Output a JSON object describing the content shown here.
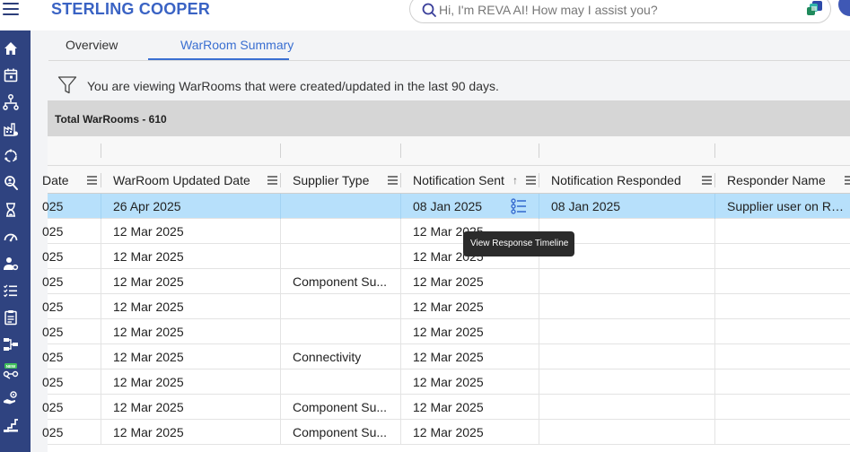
{
  "header": {
    "brand": "STERLING COOPER",
    "search_placeholder": "Hi, I'm REVA AI! How may I assist you?"
  },
  "sidebar": {
    "items": [
      "home-icon",
      "calendar-icon",
      "hierarchy-icon",
      "factory-icon",
      "cycle-icon",
      "search-person-icon",
      "hourglass-icon",
      "gauge-icon",
      "user-settings-icon",
      "list-check-icon",
      "clipboard-icon",
      "org-chart-icon",
      "new-network-icon",
      "hand-gear-icon",
      "stairs-icon"
    ],
    "new_badge": "NEW"
  },
  "tabs": [
    {
      "label": "Overview",
      "active": false
    },
    {
      "label": "WarRoom Summary",
      "active": true
    }
  ],
  "filter_text": "You are viewing WarRooms that were created/updated in the last 90 days.",
  "total_label": "Total WarRooms - 610",
  "columns": {
    "c0": "Date",
    "c1": "WarRoom Updated Date",
    "c2": "Supplier Type",
    "c3": "Notification Sent",
    "c3_sort": "↑",
    "c4": "Notification Responded",
    "c5": "Responder Name"
  },
  "rows": [
    {
      "c0": "025",
      "c1": "26 Apr 2025",
      "c2": "",
      "c3": "08 Jan 2025",
      "c4": "08 Jan 2025",
      "c5": "Supplier user on Re..."
    },
    {
      "c0": "025",
      "c1": "12 Mar 2025",
      "c2": "",
      "c3": "12 Mar 2025",
      "c4": "",
      "c5": ""
    },
    {
      "c0": "025",
      "c1": "12 Mar 2025",
      "c2": "",
      "c3": "12 Mar 2025",
      "c4": "",
      "c5": ""
    },
    {
      "c0": "025",
      "c1": "12 Mar 2025",
      "c2": "Component Su...",
      "c3": "12 Mar 2025",
      "c4": "",
      "c5": ""
    },
    {
      "c0": "025",
      "c1": "12 Mar 2025",
      "c2": "",
      "c3": "12 Mar 2025",
      "c4": "",
      "c5": ""
    },
    {
      "c0": "025",
      "c1": "12 Mar 2025",
      "c2": "",
      "c3": "12 Mar 2025",
      "c4": "",
      "c5": ""
    },
    {
      "c0": "025",
      "c1": "12 Mar 2025",
      "c2": "Connectivity",
      "c3": "12 Mar 2025",
      "c4": "",
      "c5": ""
    },
    {
      "c0": "025",
      "c1": "12 Mar 2025",
      "c2": "",
      "c3": "12 Mar 2025",
      "c4": "",
      "c5": ""
    },
    {
      "c0": "025",
      "c1": "12 Mar 2025",
      "c2": "Component Su...",
      "c3": "12 Mar 2025",
      "c4": "",
      "c5": ""
    },
    {
      "c0": "025",
      "c1": "12 Mar 2025",
      "c2": "Component Su...",
      "c3": "12 Mar 2025",
      "c4": "",
      "c5": ""
    }
  ],
  "tooltip": "View Response Timeline",
  "colors": {
    "sidebar": "#2f4380",
    "brand": "#3a63c4",
    "accent": "#3a6fd1",
    "selected_row": "#b7e0fb"
  }
}
